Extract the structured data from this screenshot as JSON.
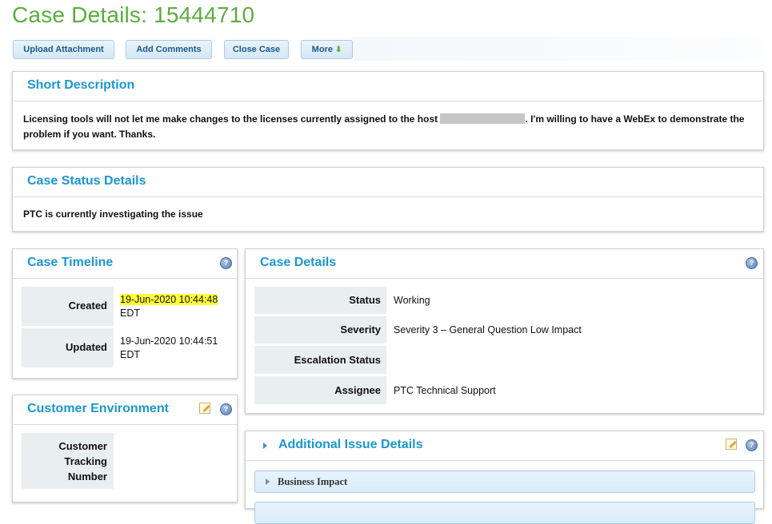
{
  "page": {
    "title": "Case Details: 15444710"
  },
  "toolbar": {
    "upload": "Upload Attachment",
    "comments": "Add Comments",
    "close": "Close Case",
    "more": "More",
    "more_icon": "arrow-down-icon"
  },
  "short_description": {
    "title": "Short Description",
    "text_before": "Licensing tools will not let me make changes to the licenses currently assigned to the host",
    "text_after": ". I'm willing to have a WebEx to demonstrate the",
    "text_line2": "problem if you want. Thanks."
  },
  "case_status": {
    "title": "Case Status Details",
    "text": "PTC is currently investigating the issue"
  },
  "timeline": {
    "title": "Case Timeline",
    "created_label": "Created",
    "created_value": "19-Jun-2020 10:44:48",
    "created_tz": "EDT",
    "updated_label": "Updated",
    "updated_value": "19-Jun-2020 10:44:51",
    "updated_tz": "EDT",
    "highlight_color": "#ffff3a"
  },
  "customer_env": {
    "title": "Customer Environment",
    "tracking_label_1": "Customer",
    "tracking_label_2": "Tracking",
    "tracking_label_3": "Number",
    "tracking_value": ""
  },
  "case_details": {
    "title": "Case Details",
    "rows": [
      {
        "label": "Status",
        "value": "Working"
      },
      {
        "label": "Severity",
        "value": "Severity 3 – General Question Low Impact"
      },
      {
        "label": "Escalation Status",
        "value": ""
      },
      {
        "label": "Assignee",
        "value": "PTC Technical Support"
      }
    ]
  },
  "additional": {
    "title": "Additional Issue Details",
    "rows": [
      {
        "label": "Business Impact"
      }
    ]
  },
  "colors": {
    "title_green": "#5cad3f",
    "panel_title_blue": "#1a97d2"
  }
}
